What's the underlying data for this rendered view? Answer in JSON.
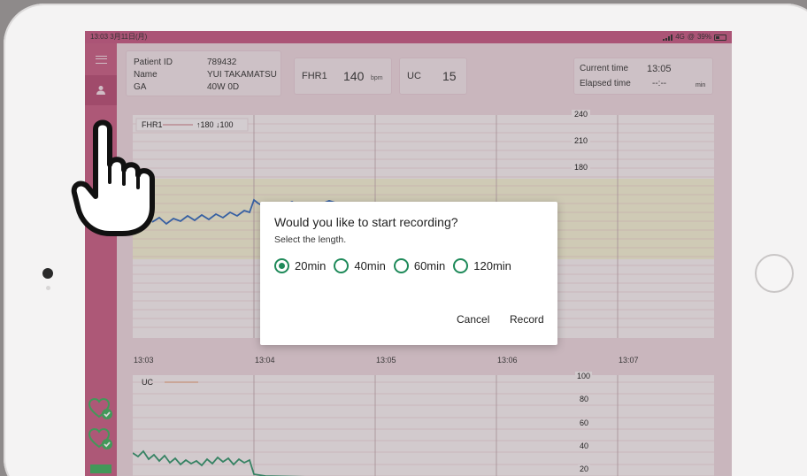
{
  "status_bar": {
    "time_date": "13:03  3月11日(月)",
    "network": "4G",
    "battery": "39%"
  },
  "patient": {
    "id_label": "Patient ID",
    "id_value": "789432",
    "name_label": "Name",
    "name_value": "YUI TAKAMATSU",
    "ga_label": "GA",
    "ga_value": "40W 0D"
  },
  "fhr": {
    "label": "FHR1",
    "value": "140",
    "unit": "bpm"
  },
  "uc": {
    "label": "UC",
    "value": "15"
  },
  "timing": {
    "current_label": "Current time",
    "current_value": "13:05",
    "elapsed_label": "Elapsed time",
    "elapsed_value": "--:--",
    "elapsed_unit": "min"
  },
  "fhr_chart": {
    "legend": "FHR1",
    "legend_limits": "↑180 ↓100",
    "y_ticks": [
      "240",
      "210",
      "180"
    ]
  },
  "time_axis": [
    "13:03",
    "13:04",
    "13:05",
    "13:06",
    "13:07"
  ],
  "uc_chart": {
    "legend": "UC",
    "y_ticks": [
      "100",
      "80",
      "60",
      "40",
      "20"
    ]
  },
  "dialog": {
    "title": "Would you like to start recording?",
    "subtitle": "Select the length.",
    "options": [
      "20min",
      "40min",
      "60min",
      "120min"
    ],
    "selected": "20min",
    "cancel_label": "Cancel",
    "record_label": "Record"
  },
  "colors": {
    "accent": "#c24f79",
    "radio": "#1f8a5a",
    "fhr_trace": "#1f5bb5",
    "uc_trace": "#1e8a5e",
    "normal_band": "#f1edcf"
  }
}
